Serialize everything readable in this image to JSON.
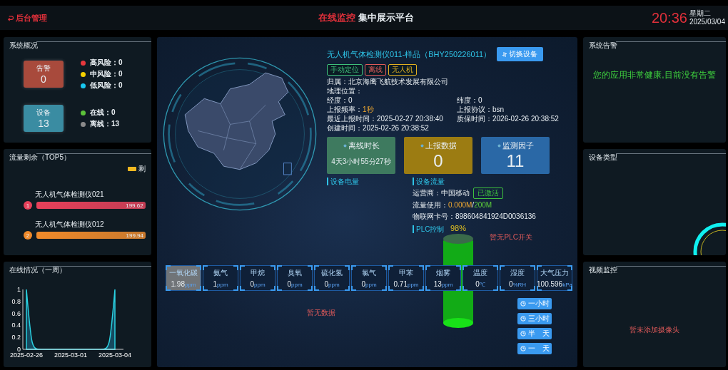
{
  "header": {
    "back_label": "后台管理",
    "title_highlight": "在线监控",
    "title_rest": "集中展示平台",
    "time": "20:36",
    "weekday": "星期二",
    "date": "2025/03/04"
  },
  "overview": {
    "title": "系统概况",
    "groups": [
      {
        "label": "告警",
        "value": "0",
        "color": "#a84a3c",
        "legend": [
          {
            "label": "高风险：0",
            "color": "#e8383d"
          },
          {
            "label": "中风险：0",
            "color": "#f5d000"
          },
          {
            "label": "低风险：0",
            "color": "#18c8f0"
          }
        ]
      },
      {
        "label": "设备",
        "value": "13",
        "color": "#3a8ca2",
        "legend": [
          {
            "label": "在线：0",
            "color": "#5cc23a"
          },
          {
            "label": "离线：13",
            "color": "#8a8a8a"
          }
        ]
      }
    ]
  },
  "traffic": {
    "title": "流量剩余（TOP5）",
    "legend": "剩",
    "items": [
      {
        "rank": "1",
        "name": "无人机气体检测仪021",
        "value": "199.62",
        "level": 0.998,
        "color": "#e8405a"
      },
      {
        "rank": "2",
        "name": "无人机气体检测仪012",
        "value": "199.94",
        "level": 1,
        "color": "#f08a2a"
      }
    ]
  },
  "online": {
    "title": "在线情况（一周）",
    "chart_data": {
      "type": "area",
      "categories": [
        "2025-02-26",
        null,
        null,
        "2025-03-01",
        null,
        null,
        "2025-03-04"
      ],
      "ylim": [
        0,
        1
      ],
      "yticks": [
        0,
        0.2,
        0.4,
        0.6,
        0.8,
        1
      ],
      "series": [
        {
          "color": "#2ad0e0",
          "values": [
            1,
            0,
            0,
            0,
            0,
            0,
            1
          ]
        }
      ]
    }
  },
  "device": {
    "name": "无人机气体检测仪011-样品（BHY250226011）",
    "switch_button": "切换设备",
    "tags": [
      {
        "label": "手动定位",
        "color": "#3ec07a"
      },
      {
        "label": "离线",
        "color": "#e05a5a"
      },
      {
        "label": "无人机",
        "color": "#e0b020"
      }
    ],
    "fields": [
      {
        "label": "归属：",
        "value": "北京海鹰飞航技术发展有限公司",
        "accent": false
      },
      {
        "label": "地理位置："
      },
      {
        "label": "经度：",
        "value": "0",
        "accent": false
      },
      {
        "label": "纬度：",
        "value": "0",
        "accent": false
      },
      {
        "label": "上报频率：",
        "value": "1秒",
        "accent": true
      },
      {
        "label": "上报协议：",
        "value": "bsn",
        "accent": false
      },
      {
        "label": "最近上报时间：",
        "value": "2025-02-27 20:38:40",
        "accent": false
      },
      {
        "label": "质保时间：",
        "value": "2026-02-26 20:38:52",
        "accent": false
      },
      {
        "label": "创建时间：",
        "value": "2025-02-26 20:38:52",
        "accent": false
      }
    ],
    "stats": [
      {
        "label": "离线时长",
        "value": "4天3小时55分27秒",
        "kind": "text",
        "color": "#3e7a5f"
      },
      {
        "label": "上报数据",
        "value": "0",
        "kind": "number",
        "color": "#9c7c12"
      },
      {
        "label": "监测因子",
        "value": "11",
        "kind": "number",
        "color": "#2a68a6"
      }
    ]
  },
  "battery": {
    "title": "设备电量",
    "reading": "98%",
    "level": 0.98
  },
  "flow": {
    "title": "设备流量",
    "carrier_label": "运营商：",
    "carrier": "中国移动",
    "status": "已激活",
    "usage_label": "流量使用：",
    "used": "0.000M",
    "separator": "/",
    "total": "200M",
    "card_label": "物联网卡号：",
    "card": "898604841924D0036136"
  },
  "plc": {
    "title": "PLC控制",
    "empty": "暂无PLC开关"
  },
  "sensors": [
    {
      "name": "一氧化碳",
      "value": "1.98",
      "unit": "ppm",
      "selected": true
    },
    {
      "name": "氨气",
      "value": "1",
      "unit": "ppm",
      "selected": false
    },
    {
      "name": "甲烷",
      "value": "0",
      "unit": "ppm",
      "selected": false
    },
    {
      "name": "臭氧",
      "value": "0",
      "unit": "ppm",
      "selected": false
    },
    {
      "name": "硫化氢",
      "value": "0",
      "unit": "ppm",
      "selected": false
    },
    {
      "name": "氯气",
      "value": "0",
      "unit": "ppm",
      "selected": false
    },
    {
      "name": "甲苯",
      "value": "0.71",
      "unit": "ppm",
      "selected": false
    },
    {
      "name": "烟雾",
      "value": "13",
      "unit": "ppm",
      "selected": false
    },
    {
      "name": "温度",
      "value": "0",
      "unit": "℃",
      "selected": false
    },
    {
      "name": "湿度",
      "value": "0",
      "unit": "%RH",
      "selected": false
    },
    {
      "name": "大气压力",
      "value": "100.596",
      "unit": "kPa",
      "selected": false
    }
  ],
  "history_empty": "暂无数据",
  "ranges": [
    "一小时",
    "三小时",
    "半　天",
    "一　天"
  ],
  "alarms": {
    "title": "系统告警",
    "message": "您的应用非常健康,目前没有告警"
  },
  "types": {
    "title": "设备类型"
  },
  "video": {
    "title": "视频监控",
    "empty": "暂未添加摄像头"
  }
}
